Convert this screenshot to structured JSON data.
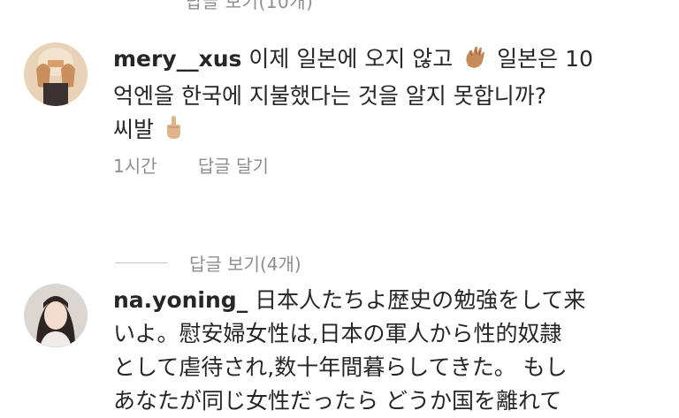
{
  "top_partial": {
    "text": "답글 보기(10개)"
  },
  "comments": [
    {
      "username": "mery__xus",
      "line1": "이제 일본에 오지 않고",
      "line1b": "일본은 10",
      "line2": "억엔을 한국에 지불했다는 것을 알지 못합니까?",
      "line3": "씨발",
      "time": "1시간",
      "reply_label": "답글 달기"
    },
    {
      "username": "na.yoning_",
      "line1": "日本人たちよ歴史の勉強をして来",
      "line2": "いよ。慰安婦女性は,日本の軍人から性的奴隷",
      "line3": "として虐待され,数十年間暮らしてきた。 もし",
      "line4": "あなたが同じ女性だったら どうか国を離れて"
    }
  ],
  "view_replies": {
    "label": "답글 보기(4개)"
  },
  "icons": [
    "waving-hand-icon",
    "middle-finger-icon"
  ],
  "colors": {
    "text": "#262626",
    "secondary": "#8e8e8e"
  }
}
